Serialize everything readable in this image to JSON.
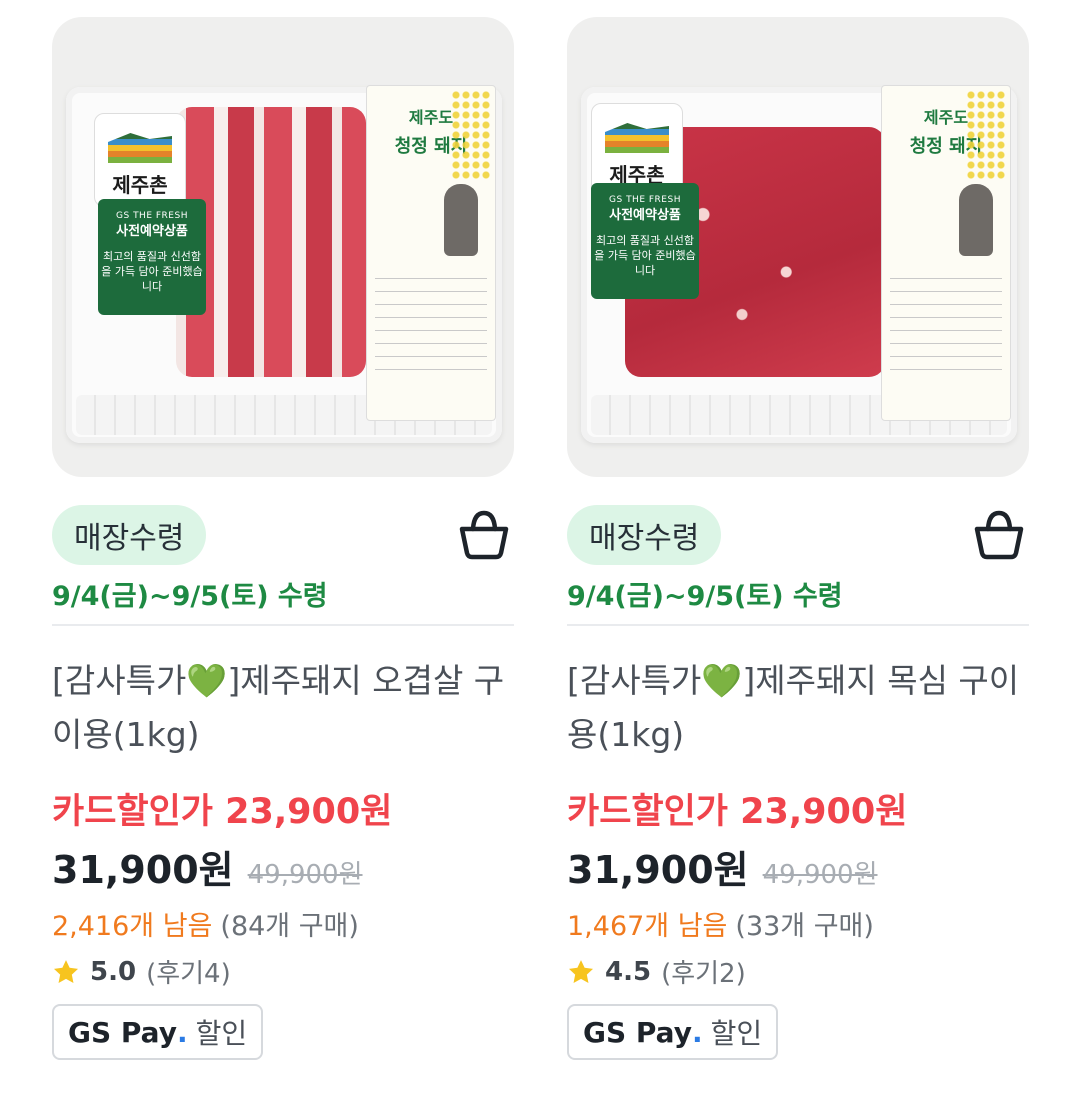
{
  "products": [
    {
      "badge": "매장수령",
      "pickup": "9/4(금)~9/5(토) 수령",
      "title_pre": "[감사특가",
      "title_heart": "💚",
      "title_post": "]제주돼지 오겹살 구이용(1kg)",
      "card_price": "카드할인가 23,900원",
      "price": "31,900원",
      "original_price": "49,900원",
      "stock": "2,416개 남음",
      "bought": "(84개 구매)",
      "rating": "5.0",
      "reviews": "(후기4)",
      "pay_brand": "GS Pay",
      "pay_dot": ".",
      "pay_text": "할인",
      "image": {
        "brand": "제주촌",
        "tag_line1": "GS THE FRESH",
        "tag_line2": "사전예약상품",
        "tag_line3": "최고의 품질과 신선함을 가득 담아 준비했습니다",
        "label_title1": "제주도",
        "label_title2": "청정 돼지"
      }
    },
    {
      "badge": "매장수령",
      "pickup": "9/4(금)~9/5(토) 수령",
      "title_pre": "[감사특가",
      "title_heart": "💚",
      "title_post": "]제주돼지 목심 구이용(1kg)",
      "card_price": "카드할인가 23,900원",
      "price": "31,900원",
      "original_price": "49,900원",
      "stock": "1,467개 남음",
      "bought": "(33개 구매)",
      "rating": "4.5",
      "reviews": "(후기2)",
      "pay_brand": "GS Pay",
      "pay_dot": ".",
      "pay_text": "할인",
      "image": {
        "brand": "제주촌",
        "tag_line1": "GS THE FRESH",
        "tag_line2": "사전예약상품",
        "tag_line3": "최고의 품질과 신선함을 가득 담아 준비했습니다",
        "label_title1": "제주도",
        "label_title2": "청정 돼지"
      }
    }
  ],
  "icons": {
    "cart": "basket-icon",
    "star": "star-icon"
  },
  "colors": {
    "badge_bg": "#dcf5e6",
    "pickup_green": "#1e8a43",
    "card_price_red": "#f0444c",
    "stock_orange": "#f07a1e",
    "star_yellow": "#f7c41f"
  }
}
